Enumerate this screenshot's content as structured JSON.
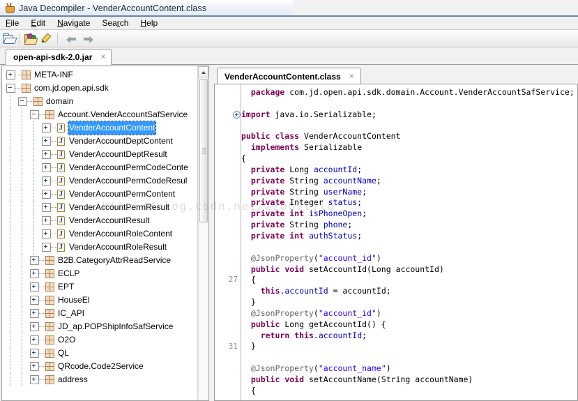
{
  "window": {
    "title": "Java Decompiler - VenderAccountContent.class",
    "app_icon": "java-cup-icon"
  },
  "menubar": {
    "items": [
      {
        "label": "File",
        "mnemonic": "F"
      },
      {
        "label": "Edit",
        "mnemonic": "E"
      },
      {
        "label": "Navigate",
        "mnemonic": "N"
      },
      {
        "label": "Search",
        "mnemonic": "r"
      },
      {
        "label": "Help",
        "mnemonic": "H"
      }
    ]
  },
  "toolbar": {
    "buttons": [
      {
        "name": "open-file-button",
        "icon": "open-folder-icon"
      },
      {
        "name": "open-recent-button",
        "icon": "folder-dots-icon"
      },
      {
        "name": "edit-button",
        "icon": "pencil-icon"
      },
      {
        "name": "back-button",
        "icon": "arrow-left-icon"
      },
      {
        "name": "forward-button",
        "icon": "arrow-right-icon"
      }
    ]
  },
  "jar_tabs": [
    {
      "label": "open-api-sdk-2.0.jar",
      "close": "×",
      "active": true
    }
  ],
  "tree": {
    "nodes": [
      {
        "label": "META-INF",
        "depth": 0,
        "icon": "package-icon",
        "state": "collapsed",
        "selected": false
      },
      {
        "label": "com.jd.open.api.sdk",
        "depth": 0,
        "icon": "package-icon",
        "state": "expanded",
        "selected": false
      },
      {
        "label": "domain",
        "depth": 1,
        "icon": "package-icon",
        "state": "expanded",
        "selected": false
      },
      {
        "label": "Account.VenderAccountSafService",
        "depth": 2,
        "icon": "package-icon",
        "state": "expanded",
        "selected": false
      },
      {
        "label": "VenderAccountContent",
        "depth": 3,
        "icon": "class-icon",
        "state": "collapsed",
        "selected": true
      },
      {
        "label": "VenderAccountDeptContent",
        "depth": 3,
        "icon": "class-icon",
        "state": "collapsed",
        "selected": false
      },
      {
        "label": "VenderAccountDeptResult",
        "depth": 3,
        "icon": "class-icon",
        "state": "collapsed",
        "selected": false
      },
      {
        "label": "VenderAccountPermCodeConte",
        "depth": 3,
        "icon": "class-icon",
        "state": "collapsed",
        "selected": false
      },
      {
        "label": "VenderAccountPermCodeResul",
        "depth": 3,
        "icon": "class-icon",
        "state": "collapsed",
        "selected": false
      },
      {
        "label": "VenderAccountPermContent",
        "depth": 3,
        "icon": "class-icon",
        "state": "collapsed",
        "selected": false
      },
      {
        "label": "VenderAccountPermResult",
        "depth": 3,
        "icon": "class-icon",
        "state": "collapsed",
        "selected": false
      },
      {
        "label": "VenderAccountResult",
        "depth": 3,
        "icon": "class-icon",
        "state": "collapsed",
        "selected": false
      },
      {
        "label": "VenderAccountRoleContent",
        "depth": 3,
        "icon": "class-icon",
        "state": "collapsed",
        "selected": false
      },
      {
        "label": "VenderAccountRoleResult",
        "depth": 3,
        "icon": "class-icon",
        "state": "collapsed",
        "selected": false
      },
      {
        "label": "B2B.CategoryAttrReadService",
        "depth": 2,
        "icon": "package-icon",
        "state": "collapsed",
        "selected": false
      },
      {
        "label": "ECLP",
        "depth": 2,
        "icon": "package-icon",
        "state": "collapsed",
        "selected": false
      },
      {
        "label": "EPT",
        "depth": 2,
        "icon": "package-icon",
        "state": "collapsed",
        "selected": false
      },
      {
        "label": "HouseEI",
        "depth": 2,
        "icon": "package-icon",
        "state": "collapsed",
        "selected": false
      },
      {
        "label": "IC_API",
        "depth": 2,
        "icon": "package-icon",
        "state": "collapsed",
        "selected": false
      },
      {
        "label": "JD_ap.POPShipInfoSafService",
        "depth": 2,
        "icon": "package-icon",
        "state": "collapsed",
        "selected": false
      },
      {
        "label": "O2O",
        "depth": 2,
        "icon": "package-icon",
        "state": "collapsed",
        "selected": false
      },
      {
        "label": "QL",
        "depth": 2,
        "icon": "package-icon",
        "state": "collapsed",
        "selected": false
      },
      {
        "label": "QRcode.Code2Service",
        "depth": 2,
        "icon": "package-icon",
        "state": "collapsed",
        "selected": false
      },
      {
        "label": "address",
        "depth": 2,
        "icon": "package-icon",
        "state": "collapsed",
        "selected": false
      }
    ],
    "scrollbar": {
      "name": "tree-vertical-scrollbar"
    }
  },
  "editor": {
    "tabs": [
      {
        "label": "VenderAccountContent.class",
        "close": "×",
        "active": true
      }
    ],
    "line_numbers": [
      {
        "line": "27",
        "row": 17
      },
      {
        "line": "31",
        "row": 23
      }
    ],
    "fold_markers": [
      {
        "row": 2
      }
    ],
    "code_lines": [
      [
        {
          "t": "  ",
          "c": "pln"
        },
        {
          "t": "package",
          "c": "kw"
        },
        {
          "t": " com.jd.open.api.sdk.domain.Account.VenderAccountSafService;",
          "c": "pln"
        }
      ],
      [
        {
          "t": "",
          "c": "pln"
        }
      ],
      [
        {
          "t": "",
          "c": "pln"
        },
        {
          "t": "import",
          "c": "kw"
        },
        {
          "t": " java.io.Serializable;",
          "c": "pln"
        }
      ],
      [
        {
          "t": "",
          "c": "pln"
        }
      ],
      [
        {
          "t": "",
          "c": "pln"
        },
        {
          "t": "public class",
          "c": "kw"
        },
        {
          "t": " VenderAccountContent",
          "c": "pln"
        }
      ],
      [
        {
          "t": "  ",
          "c": "pln"
        },
        {
          "t": "implements",
          "c": "kw"
        },
        {
          "t": " Serializable",
          "c": "pln"
        }
      ],
      [
        {
          "t": "{",
          "c": "pln"
        }
      ],
      [
        {
          "t": "  ",
          "c": "pln"
        },
        {
          "t": "private",
          "c": "kw"
        },
        {
          "t": " Long ",
          "c": "pln"
        },
        {
          "t": "accountId",
          "c": "fld"
        },
        {
          "t": ";",
          "c": "pln"
        }
      ],
      [
        {
          "t": "  ",
          "c": "pln"
        },
        {
          "t": "private",
          "c": "kw"
        },
        {
          "t": " String ",
          "c": "pln"
        },
        {
          "t": "accountName",
          "c": "fld"
        },
        {
          "t": ";",
          "c": "pln"
        }
      ],
      [
        {
          "t": "  ",
          "c": "pln"
        },
        {
          "t": "private",
          "c": "kw"
        },
        {
          "t": " String ",
          "c": "pln"
        },
        {
          "t": "userName",
          "c": "fld"
        },
        {
          "t": ";",
          "c": "pln"
        }
      ],
      [
        {
          "t": "  ",
          "c": "pln"
        },
        {
          "t": "private",
          "c": "kw"
        },
        {
          "t": " Integer ",
          "c": "pln"
        },
        {
          "t": "status",
          "c": "fld"
        },
        {
          "t": ";",
          "c": "pln"
        }
      ],
      [
        {
          "t": "  ",
          "c": "pln"
        },
        {
          "t": "private",
          "c": "kw"
        },
        {
          "t": " ",
          "c": "pln"
        },
        {
          "t": "int",
          "c": "kw"
        },
        {
          "t": " ",
          "c": "pln"
        },
        {
          "t": "isPhoneOpen",
          "c": "fld"
        },
        {
          "t": ";",
          "c": "pln"
        }
      ],
      [
        {
          "t": "  ",
          "c": "pln"
        },
        {
          "t": "private",
          "c": "kw"
        },
        {
          "t": " String ",
          "c": "pln"
        },
        {
          "t": "phone",
          "c": "fld"
        },
        {
          "t": ";",
          "c": "pln"
        }
      ],
      [
        {
          "t": "  ",
          "c": "pln"
        },
        {
          "t": "private",
          "c": "kw"
        },
        {
          "t": " ",
          "c": "pln"
        },
        {
          "t": "int",
          "c": "kw"
        },
        {
          "t": " ",
          "c": "pln"
        },
        {
          "t": "authStatus",
          "c": "fld"
        },
        {
          "t": ";",
          "c": "pln"
        }
      ],
      [
        {
          "t": "",
          "c": "pln"
        }
      ],
      [
        {
          "t": "  ",
          "c": "pln"
        },
        {
          "t": "@JsonProperty",
          "c": "ann"
        },
        {
          "t": "(",
          "c": "pln"
        },
        {
          "t": "\"account_id\"",
          "c": "str"
        },
        {
          "t": ")",
          "c": "pln"
        }
      ],
      [
        {
          "t": "  ",
          "c": "pln"
        },
        {
          "t": "public void",
          "c": "kw"
        },
        {
          "t": " setAccountId(Long accountId)",
          "c": "pln"
        }
      ],
      [
        {
          "t": "  {",
          "c": "pln"
        }
      ],
      [
        {
          "t": "    ",
          "c": "pln"
        },
        {
          "t": "this",
          "c": "kw"
        },
        {
          "t": ".",
          "c": "pln"
        },
        {
          "t": "accountId",
          "c": "fld"
        },
        {
          "t": " = accountId;",
          "c": "pln"
        }
      ],
      [
        {
          "t": "  }",
          "c": "pln"
        }
      ],
      [
        {
          "t": "  ",
          "c": "pln"
        },
        {
          "t": "@JsonProperty",
          "c": "ann"
        },
        {
          "t": "(",
          "c": "pln"
        },
        {
          "t": "\"account_id\"",
          "c": "str"
        },
        {
          "t": ")",
          "c": "pln"
        }
      ],
      [
        {
          "t": "  ",
          "c": "pln"
        },
        {
          "t": "public",
          "c": "kw"
        },
        {
          "t": " Long getAccountId() {",
          "c": "pln"
        }
      ],
      [
        {
          "t": "    ",
          "c": "pln"
        },
        {
          "t": "return",
          "c": "kw"
        },
        {
          "t": " ",
          "c": "pln"
        },
        {
          "t": "this",
          "c": "kw"
        },
        {
          "t": ".",
          "c": "pln"
        },
        {
          "t": "accountId",
          "c": "fld"
        },
        {
          "t": ";",
          "c": "pln"
        }
      ],
      [
        {
          "t": "  }",
          "c": "pln"
        }
      ],
      [
        {
          "t": "",
          "c": "pln"
        }
      ],
      [
        {
          "t": "  ",
          "c": "pln"
        },
        {
          "t": "@JsonProperty",
          "c": "ann"
        },
        {
          "t": "(",
          "c": "pln"
        },
        {
          "t": "\"account_name\"",
          "c": "str"
        },
        {
          "t": ")",
          "c": "pln"
        }
      ],
      [
        {
          "t": "  ",
          "c": "pln"
        },
        {
          "t": "public void",
          "c": "kw"
        },
        {
          "t": " setAccountName(String accountName)",
          "c": "pln"
        }
      ],
      [
        {
          "t": "  {",
          "c": "pln"
        }
      ]
    ]
  },
  "watermark": {
    "text": "http://blog.csdn.net/wzp09tjlg"
  },
  "colors": {
    "selection": "#3399ff",
    "keyword": "#7f0055",
    "string": "#2a00ff",
    "field": "#0000c0",
    "annotation": "#646464",
    "titlebar_accent": "#5d7fa3"
  }
}
